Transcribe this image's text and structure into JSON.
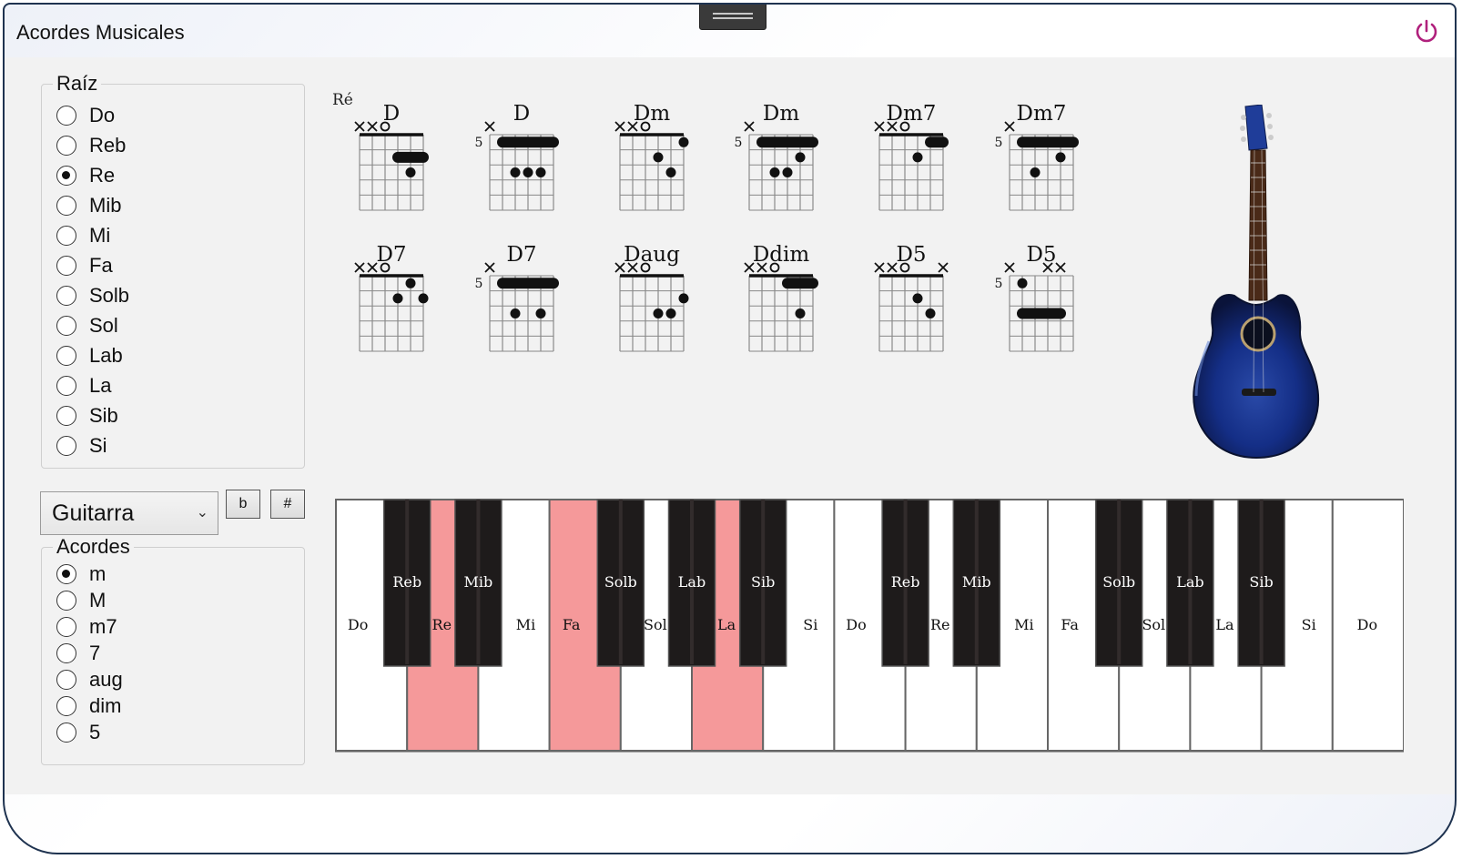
{
  "app": {
    "title": "Acordes Musicales"
  },
  "colors": {
    "highlight": "#f5999a",
    "black_key": "#1e1b1b",
    "white_key": "#ffffff"
  },
  "root_group": {
    "legend": "Raíz",
    "options": [
      "Do",
      "Reb",
      "Re",
      "Mib",
      "Mi",
      "Fa",
      "Solb",
      "Sol",
      "Lab",
      "La",
      "Sib",
      "Si"
    ],
    "selected": "Re"
  },
  "instrument": {
    "selected": "Guitarra"
  },
  "flat_button": "b",
  "sharp_button": "#",
  "chord_group": {
    "legend": "Acordes",
    "options": [
      "m",
      "M",
      "m7",
      "7",
      "aug",
      "dim",
      "5"
    ],
    "selected": "m"
  },
  "diagrams": {
    "root_label": "Ré",
    "chords": [
      {
        "name": "D",
        "fret_label": "",
        "markers": [
          "x",
          "x",
          "o",
          "",
          "",
          ""
        ],
        "barres": [
          {
            "fret": 2,
            "from": 4,
            "to": 6
          }
        ],
        "dots": [
          {
            "string": 5,
            "fret": 3
          }
        ]
      },
      {
        "name": "D",
        "fret_label": "5",
        "markers": [
          "x",
          "",
          "",
          "",
          "",
          ""
        ],
        "barres": [
          {
            "fret": 1,
            "from": 2,
            "to": 6
          }
        ],
        "dots": [
          {
            "string": 3,
            "fret": 3
          },
          {
            "string": 4,
            "fret": 3
          },
          {
            "string": 5,
            "fret": 3
          }
        ]
      },
      {
        "name": "Dm",
        "fret_label": "",
        "markers": [
          "x",
          "x",
          "o",
          "",
          "",
          ""
        ],
        "barres": [],
        "dots": [
          {
            "string": 6,
            "fret": 1
          },
          {
            "string": 4,
            "fret": 2
          },
          {
            "string": 5,
            "fret": 3
          }
        ]
      },
      {
        "name": "Dm",
        "fret_label": "5",
        "markers": [
          "x",
          "",
          "",
          "",
          "",
          ""
        ],
        "barres": [
          {
            "fret": 1,
            "from": 2,
            "to": 6
          }
        ],
        "dots": [
          {
            "string": 5,
            "fret": 2
          },
          {
            "string": 3,
            "fret": 3
          },
          {
            "string": 4,
            "fret": 3
          }
        ]
      },
      {
        "name": "Dm7",
        "fret_label": "",
        "markers": [
          "x",
          "x",
          "o",
          "",
          "",
          ""
        ],
        "barres": [
          {
            "fret": 1,
            "from": 5,
            "to": 6
          }
        ],
        "dots": [
          {
            "string": 4,
            "fret": 2
          }
        ]
      },
      {
        "name": "Dm7",
        "fret_label": "5",
        "markers": [
          "x",
          "",
          "",
          "",
          "",
          ""
        ],
        "barres": [
          {
            "fret": 1,
            "from": 2,
            "to": 6
          }
        ],
        "dots": [
          {
            "string": 5,
            "fret": 2
          },
          {
            "string": 3,
            "fret": 3
          }
        ]
      },
      {
        "name": "D7",
        "fret_label": "",
        "markers": [
          "x",
          "x",
          "o",
          "",
          "",
          ""
        ],
        "barres": [],
        "dots": [
          {
            "string": 5,
            "fret": 1
          },
          {
            "string": 4,
            "fret": 2
          },
          {
            "string": 6,
            "fret": 2
          }
        ]
      },
      {
        "name": "D7",
        "fret_label": "5",
        "markers": [
          "x",
          "",
          "",
          "",
          "",
          ""
        ],
        "barres": [
          {
            "fret": 1,
            "from": 2,
            "to": 6
          }
        ],
        "dots": [
          {
            "string": 3,
            "fret": 3
          },
          {
            "string": 5,
            "fret": 3
          }
        ]
      },
      {
        "name": "Daug",
        "fret_label": "",
        "markers": [
          "x",
          "x",
          "o",
          "",
          "",
          ""
        ],
        "barres": [],
        "dots": [
          {
            "string": 6,
            "fret": 2
          },
          {
            "string": 4,
            "fret": 3
          },
          {
            "string": 5,
            "fret": 3
          }
        ]
      },
      {
        "name": "Ddim",
        "fret_label": "",
        "markers": [
          "x",
          "x",
          "o",
          "",
          "",
          ""
        ],
        "barres": [
          {
            "fret": 1,
            "from": 4,
            "to": 6
          }
        ],
        "dots": [
          {
            "string": 5,
            "fret": 3
          }
        ]
      },
      {
        "name": "D5",
        "fret_label": "",
        "markers": [
          "x",
          "x",
          "o",
          "",
          "",
          "x"
        ],
        "barres": [],
        "dots": [
          {
            "string": 4,
            "fret": 2
          },
          {
            "string": 5,
            "fret": 3
          }
        ]
      },
      {
        "name": "D5",
        "fret_label": "5",
        "markers": [
          "x",
          "",
          "",
          "x",
          "x",
          ""
        ],
        "barres": [
          {
            "fret": 3,
            "from": 2,
            "to": 5
          }
        ],
        "dots": [
          {
            "string": 2,
            "fret": 1
          }
        ]
      }
    ]
  },
  "piano": {
    "white_keys": [
      {
        "label": "Do",
        "active": false
      },
      {
        "label": "Re",
        "active": true
      },
      {
        "label": "Mi",
        "active": false
      },
      {
        "label": "Fa",
        "active": true
      },
      {
        "label": "Sol",
        "active": false
      },
      {
        "label": "La",
        "active": true
      },
      {
        "label": "Si",
        "active": false
      },
      {
        "label": "Do",
        "active": false
      },
      {
        "label": "Re",
        "active": false
      },
      {
        "label": "Mi",
        "active": false
      },
      {
        "label": "Fa",
        "active": false
      },
      {
        "label": "Sol",
        "active": false
      },
      {
        "label": "La",
        "active": false
      },
      {
        "label": "Si",
        "active": false
      },
      {
        "label": "Do",
        "active": false
      }
    ],
    "black_keys": [
      {
        "label": "Reb",
        "after": 0
      },
      {
        "label": "Mib",
        "after": 1
      },
      {
        "label": "Solb",
        "after": 3
      },
      {
        "label": "Lab",
        "after": 4
      },
      {
        "label": "Sib",
        "after": 5
      },
      {
        "label": "Reb",
        "after": 7
      },
      {
        "label": "Mib",
        "after": 8
      },
      {
        "label": "Solb",
        "after": 10
      },
      {
        "label": "Lab",
        "after": 11
      },
      {
        "label": "Sib",
        "after": 12
      }
    ]
  }
}
